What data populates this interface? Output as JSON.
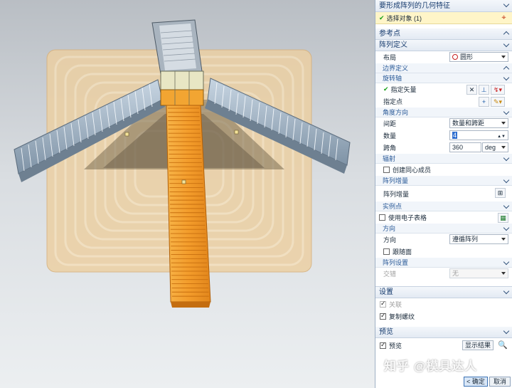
{
  "panel": {
    "title": "要形成阵列的几何特征",
    "select_object": "选择对象 (1)",
    "reference_point": "参考点",
    "array_def": "阵列定义",
    "layout_label": "布局",
    "layout_value": "圆形",
    "boundary_def": "边界定义",
    "rotation_axis": "旋转轴",
    "specify_vector": "指定矢量",
    "specify_point": "指定点",
    "angle_direction": "角度方向",
    "spacing_label": "间距",
    "spacing_value": "数量和跨距",
    "count_label": "数量",
    "count_value": "4",
    "span_label": "跨角",
    "span_value": "360",
    "span_unit": "deg",
    "radiate": "辐射",
    "create_concentric": "创建同心成员",
    "pattern_increment_head": "阵列增量",
    "pattern_increment": "阵列增量",
    "instance_point": "实例点",
    "use_spreadsheet": "使用电子表格",
    "orientation_head": "方向",
    "orientation_label": "方向",
    "orientation_value": "遵循阵列",
    "follow_face": "跟随面",
    "array_settings": "阵列设置",
    "stagger_label": "交错",
    "stagger_value": "无",
    "settings": "设置",
    "associative": "关联",
    "copy_threads": "复制螺纹",
    "preview": "预览",
    "preview_cb": "预览",
    "show_result": "显示结果",
    "ok": "< 确定 >",
    "cancel": "取消"
  },
  "watermark": "知乎 @模具达人",
  "colors": {
    "accent_check": "#19a31a",
    "selected_row": "#fff5c8",
    "escalator_orange": "#f39c2b",
    "shade_tan": "#e8c89a"
  }
}
